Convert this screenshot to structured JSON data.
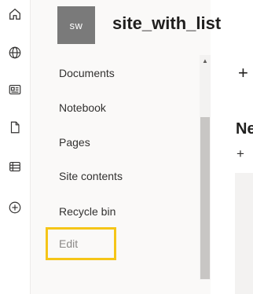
{
  "app_bar": {
    "icons": [
      "home-icon",
      "globe-icon",
      "news-icon",
      "document-icon",
      "list-icon",
      "add-icon"
    ]
  },
  "site": {
    "logo_initials": "sw",
    "title": "site_with_list"
  },
  "nav": {
    "items": [
      {
        "label": "Documents"
      },
      {
        "label": "Notebook"
      },
      {
        "label": "Pages"
      },
      {
        "label": "Site contents"
      },
      {
        "label": "Recycle bin"
      }
    ],
    "edit_label": "Edit"
  },
  "content": {
    "new_symbol": "+",
    "section_title": "Ne",
    "section_add_symbol": "+"
  },
  "colors": {
    "highlight": "#f5c518",
    "logo_bg": "#7a7a7a"
  }
}
